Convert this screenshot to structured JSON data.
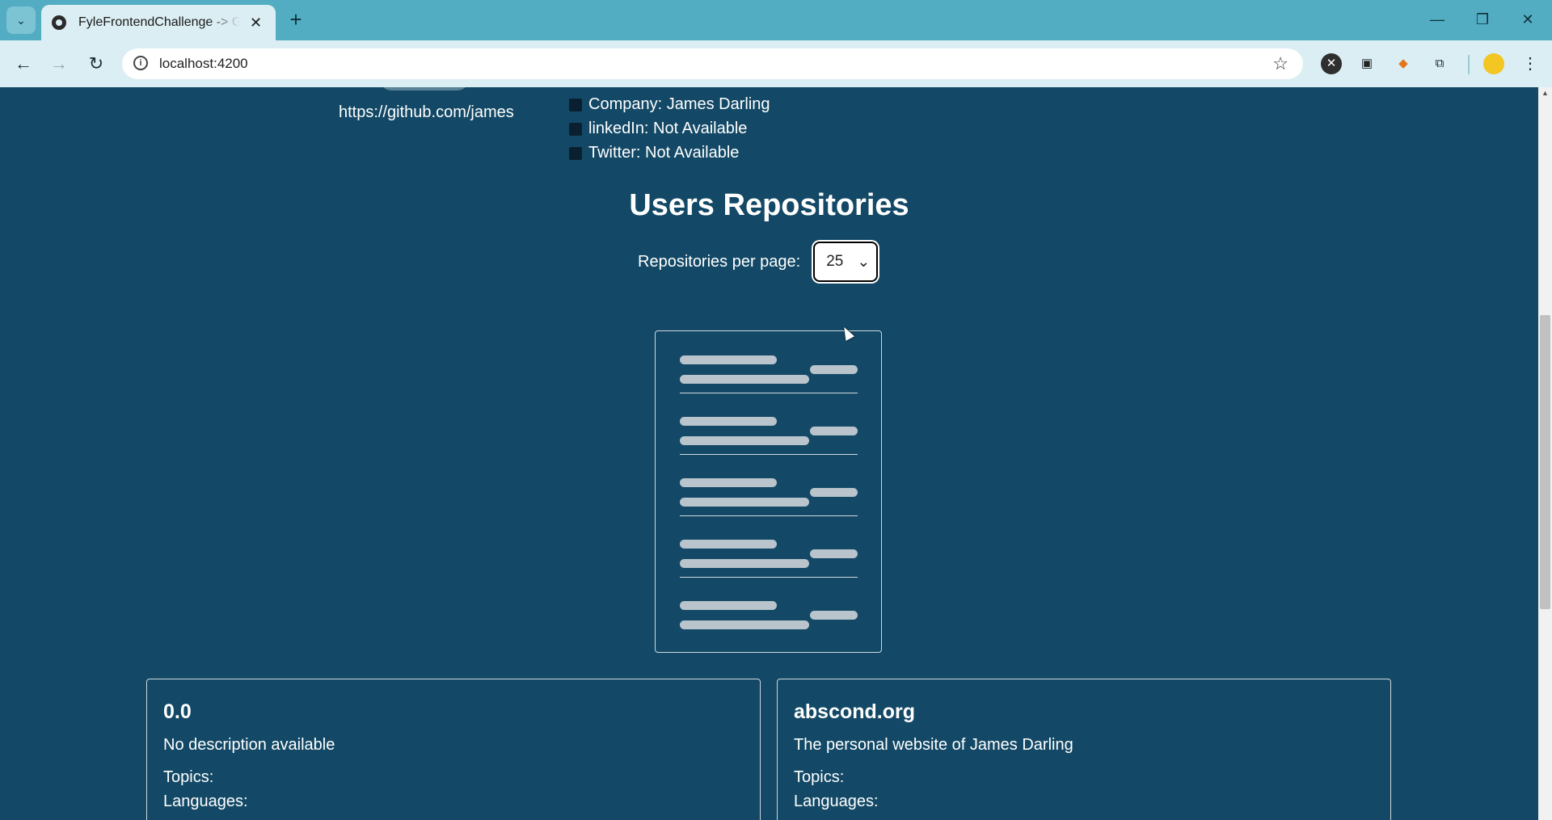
{
  "browser": {
    "tab_title": "FyleFrontendChallenge -> Github",
    "tab_close": "✕",
    "new_tab": "+",
    "url": "localhost:4200",
    "minimize": "—",
    "restore": "❐",
    "close": "✕"
  },
  "profile": {
    "github_url": "https://github.com/james",
    "company": "Company: James Darling",
    "linkedin": "linkedIn: Not Available",
    "twitter": "Twitter:  Not Available"
  },
  "repositories": {
    "heading": "Users Repositories",
    "per_page_label": "Repositories per page:",
    "per_page_value": "25",
    "cards": [
      {
        "name": "0.0",
        "description": "No description available",
        "topics_label": "Topics:",
        "languages_label": "Languages:"
      },
      {
        "name": "abscond.org",
        "description": "The personal website of James Darling",
        "topics_label": "Topics:",
        "languages_label": "Languages:"
      }
    ]
  },
  "colors": {
    "page_bg": "#134966",
    "chrome_bg": "#52adc2",
    "toolbar_bg": "#dbeef3"
  }
}
